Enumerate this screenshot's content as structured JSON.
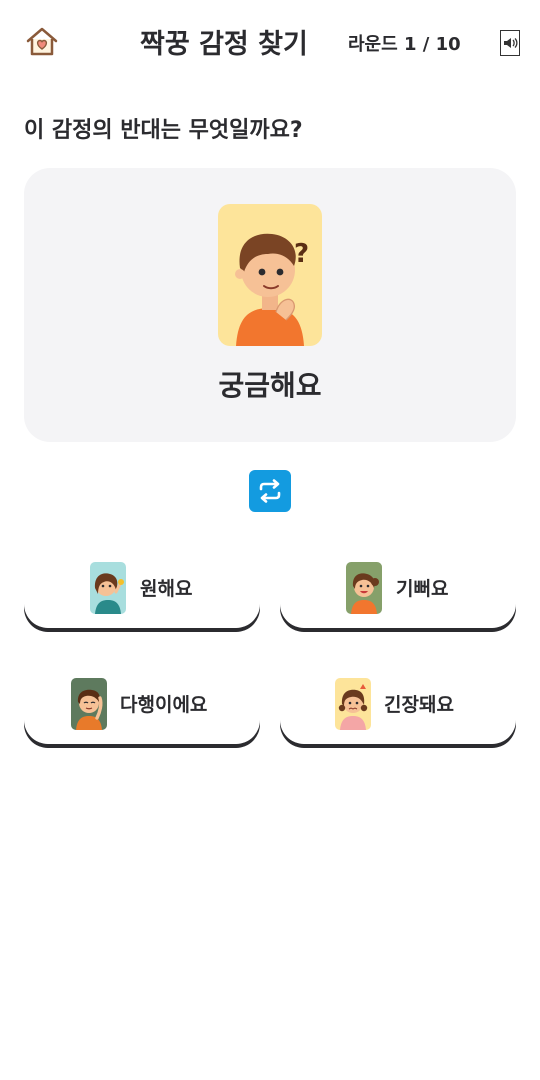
{
  "header": {
    "title": "짝꿍 감정 찾기",
    "round_label": "라운드 1 / 10"
  },
  "question": "이 감정의 반대는 무엇일까요?",
  "target": {
    "label": "궁금해요",
    "illustration": "curious-boy-illustration",
    "bg": "#fde49a"
  },
  "choices": [
    {
      "label": "원해요",
      "illustration": "wanting-girl-illustration",
      "bg": "#a8dede"
    },
    {
      "label": "기뻐요",
      "illustration": "happy-girl-illustration",
      "bg": "#86a06a"
    },
    {
      "label": "다행이에요",
      "illustration": "relieved-boy-illustration",
      "bg": "#5e7a5e"
    },
    {
      "label": "긴장돼요",
      "illustration": "nervous-girl-illustration",
      "bg": "#fde49a"
    }
  ],
  "colors": {
    "accent": "#139be0",
    "card_bg": "#f4f4f6",
    "text": "#2b2b2f"
  }
}
